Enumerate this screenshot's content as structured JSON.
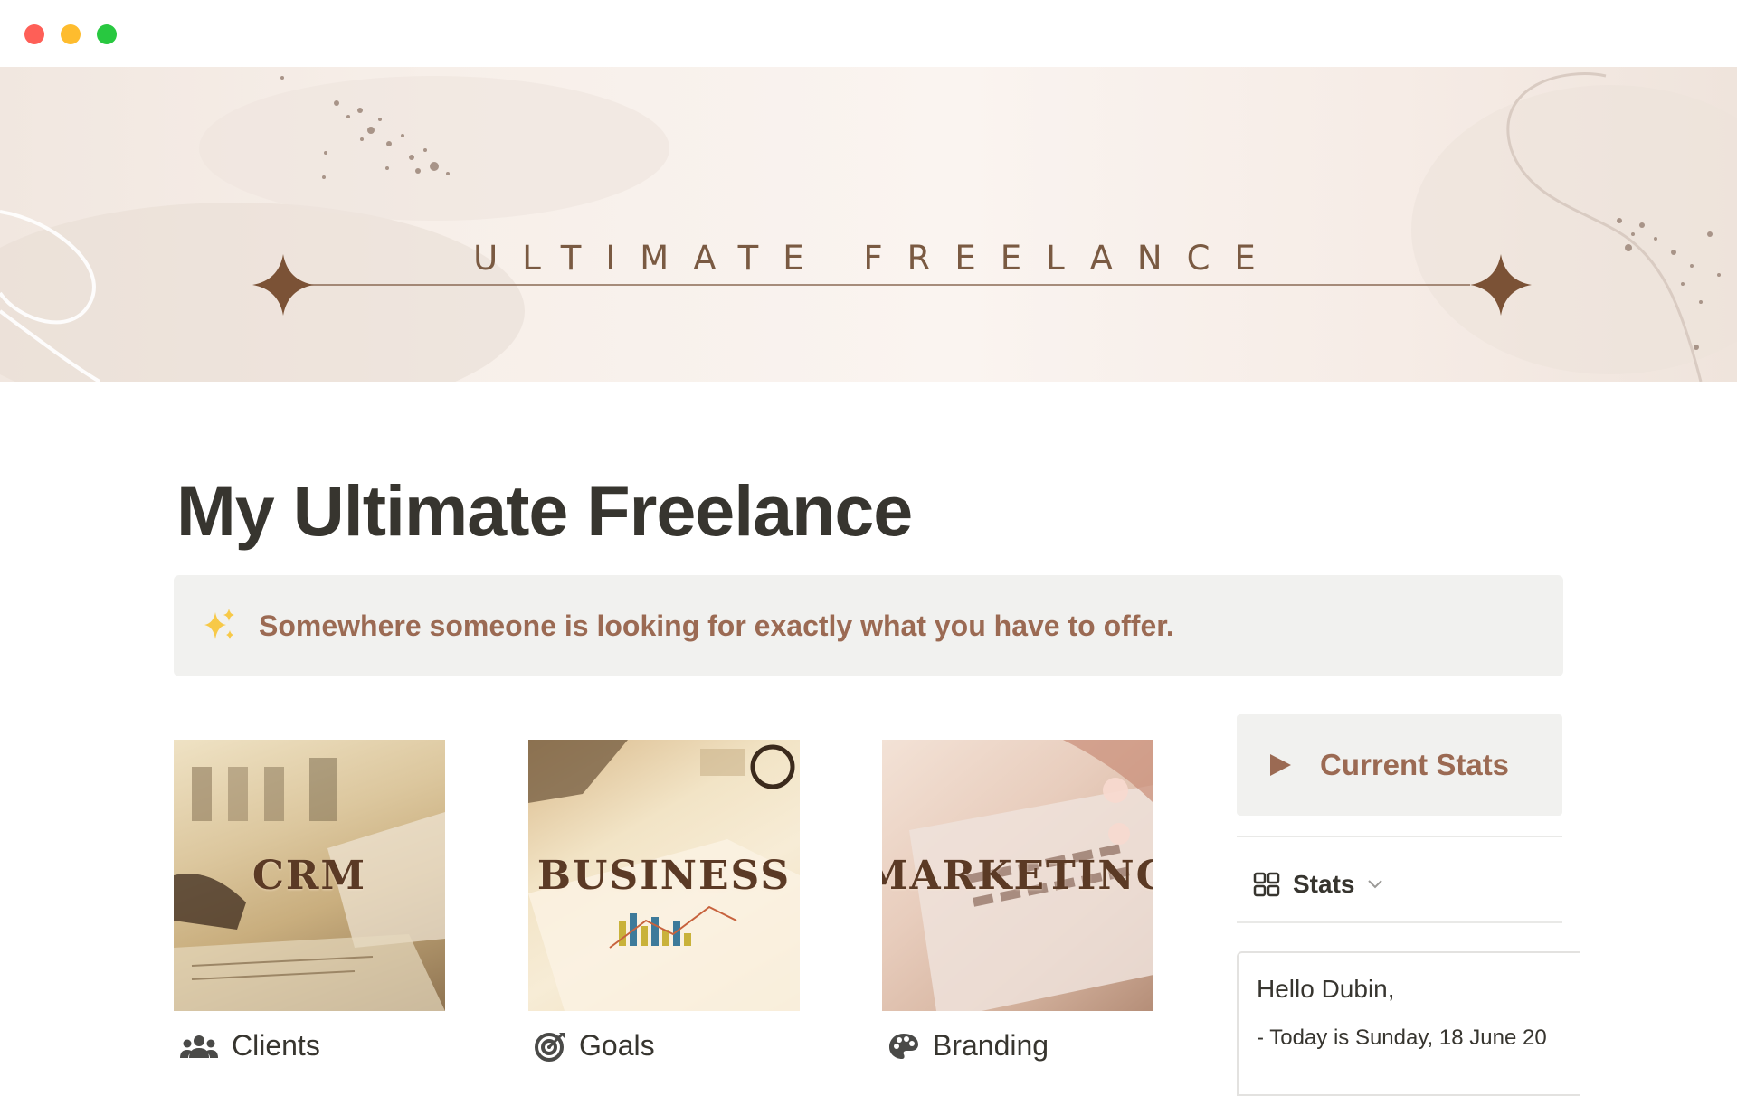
{
  "window": {
    "controls": [
      "close",
      "minimize",
      "maximize"
    ],
    "colors": {
      "close": "#fe5f57",
      "minimize": "#febc2e",
      "maximize": "#28c840"
    }
  },
  "cover": {
    "title": "ULTIMATE FREELANCE",
    "accent_color": "#7a5a42"
  },
  "page": {
    "title": "My Ultimate Freelance"
  },
  "callout": {
    "icon": "sparkles-icon",
    "text": "Somewhere someone is looking for exactly what you have to offer."
  },
  "cards": [
    {
      "image_label": "CRM",
      "icon": "people-icon",
      "caption": "Clients"
    },
    {
      "image_label": "BUSINESS",
      "icon": "target-icon",
      "caption": "Goals"
    },
    {
      "image_label": "MARKETING",
      "icon": "palette-icon",
      "caption": "Branding"
    }
  ],
  "sidebar": {
    "toggle_label": "Current Stats",
    "view": {
      "icon": "gallery-icon",
      "label": "Stats"
    },
    "stat_card": {
      "greeting": "Hello Dubin,",
      "line1": "- Today is Sunday, 18 June 20"
    }
  },
  "colors": {
    "text": "#37352f",
    "callout_text": "#9b6a53",
    "callout_bg": "#f1f1ef"
  }
}
